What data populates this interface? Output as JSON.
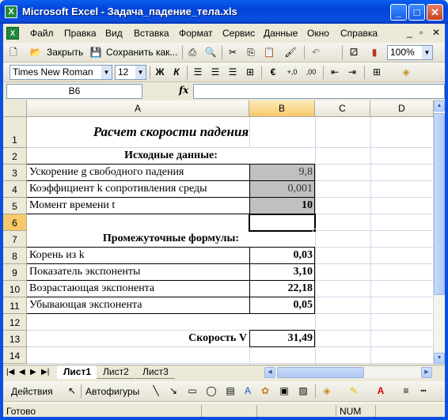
{
  "window": {
    "title": "Microsoft Excel - Задача_падение_тела.xls",
    "minimize": "_",
    "maximize": "□",
    "close": "✕"
  },
  "menu": {
    "items": [
      "Файл",
      "Правка",
      "Вид",
      "Вставка",
      "Формат",
      "Сервис",
      "Данные",
      "Окно",
      "Справка"
    ],
    "controls": [
      "_",
      "▫",
      "✕"
    ]
  },
  "toolbar_standard": {
    "open_label": "Закрыть",
    "save_label": "Сохранить как...",
    "zoom": "100%"
  },
  "toolbar_format": {
    "font": "Times New Roman",
    "size": "12",
    "bold": "Ж",
    "italic": "К",
    "currency": "€"
  },
  "formula_bar": {
    "name_box": "B6",
    "fx": "fx",
    "formula": ""
  },
  "sheet": {
    "columns": [
      "A",
      "B",
      "C",
      "D"
    ],
    "rows": [
      "1",
      "2",
      "3",
      "4",
      "5",
      "6",
      "7",
      "8",
      "9",
      "10",
      "11",
      "12",
      "13",
      "14"
    ],
    "cells": {
      "A1": "Расчет скорости падения",
      "A2": "Исходные данные:",
      "A3": "Ускорение g свободного падения",
      "B3": "9,8",
      "A4": "Коэффициент k сопротивления среды",
      "B4": "0,001",
      "A5": "Момент времени t",
      "B5": "10",
      "A7": "Промежуточные формулы:",
      "A8": "Корень из k",
      "B8": "0,03",
      "A9": "Показатель экспоненты",
      "B9": "3,10",
      "A10": "Возрастающая экспонента",
      "B10": "22,18",
      "A11": "Убывающая экспонента",
      "B11": "0,05",
      "A13": "Скорость V",
      "B13": "31,49"
    },
    "input_fill": "#c0c0c0",
    "selected_cell": "B6"
  },
  "tabs": {
    "sheets": [
      "Лист1",
      "Лист2",
      "Лист3"
    ],
    "active": "Лист1"
  },
  "drawing": {
    "actions": "Действия",
    "autoshapes": "Автофигуры"
  },
  "status": {
    "text": "Готово",
    "num": "NUM"
  }
}
